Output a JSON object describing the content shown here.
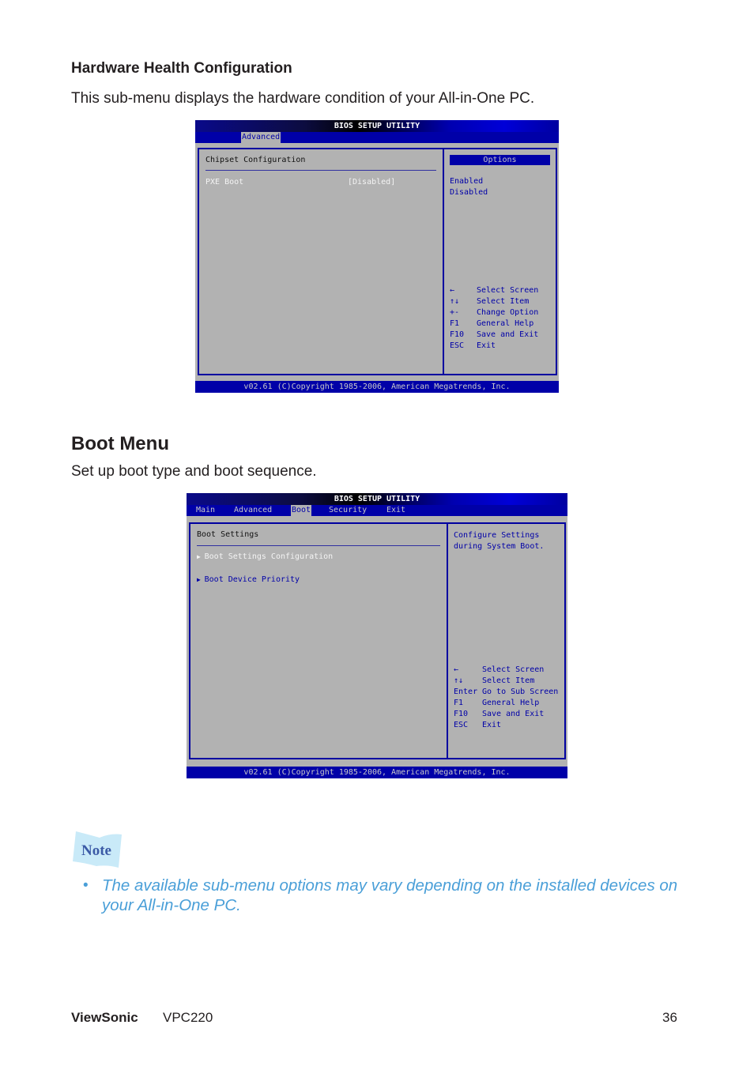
{
  "section1": {
    "heading": "Hardware Health Configuration",
    "desc": "This sub-menu displays the hardware condition of your All-in-One PC."
  },
  "bios1": {
    "title": "BIOS SETUP UTILITY",
    "tab": "Advanced",
    "panel_title": "Chipset Configuration",
    "item_label": "PXE Boot",
    "item_value": "[Disabled]",
    "options_header": "Options",
    "options": [
      "Enabled",
      "Disabled"
    ],
    "help": [
      [
        "←",
        "Select Screen"
      ],
      [
        "↑↓",
        "Select Item"
      ],
      [
        "+-",
        "Change Option"
      ],
      [
        "F1",
        "General Help"
      ],
      [
        "F10",
        "Save and Exit"
      ],
      [
        "ESC",
        "Exit"
      ]
    ],
    "footer": "v02.61 (C)Copyright 1985-2006, American Megatrends, Inc."
  },
  "section2": {
    "heading": "Boot Menu",
    "desc": "Set up boot type and boot sequence."
  },
  "bios2": {
    "title": "BIOS SETUP UTILITY",
    "tabs": [
      "Main",
      "Advanced",
      "Boot",
      "Security",
      "Exit"
    ],
    "selected_tab": "Boot",
    "panel_title": "Boot Settings",
    "items": [
      "Boot Settings Configuration",
      "Boot Device Priority"
    ],
    "description": [
      "Configure Settings",
      "during System Boot."
    ],
    "help": [
      [
        "←",
        "Select Screen"
      ],
      [
        "↑↓",
        "Select Item"
      ],
      [
        "Enter",
        "Go to Sub Screen"
      ],
      [
        "F1",
        "General Help"
      ],
      [
        "F10",
        "Save and Exit"
      ],
      [
        "ESC",
        "Exit"
      ]
    ],
    "footer": "v02.61 (C)Copyright 1985-2006, American Megatrends, Inc."
  },
  "note": {
    "label": "Note",
    "bullet": "•",
    "text": "The available sub-menu options may vary depending on the installed devices on your All-in-One PC.",
    "color": "#4a9fd8"
  },
  "footer": {
    "brand": "ViewSonic",
    "model": "VPC220",
    "page": "36"
  }
}
